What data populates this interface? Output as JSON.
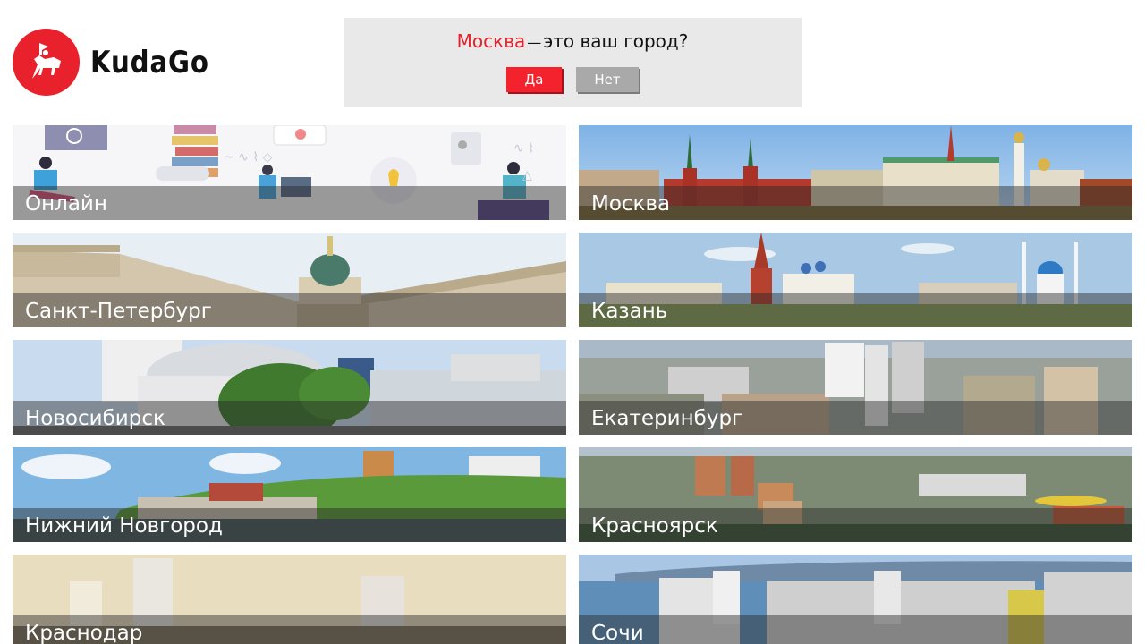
{
  "logo": {
    "text": "KudaGo"
  },
  "confirm": {
    "city": "Москва",
    "dash": "—",
    "question": "это ваш город?",
    "yes_label": "Да",
    "no_label": "Нет"
  },
  "cities": [
    {
      "label": "Онлайн"
    },
    {
      "label": "Москва"
    },
    {
      "label": "Санкт-Петербург"
    },
    {
      "label": "Казань"
    },
    {
      "label": "Новосибирск"
    },
    {
      "label": "Екатеринбург"
    },
    {
      "label": "Нижний Новгород"
    },
    {
      "label": "Красноярск"
    },
    {
      "label": "Краснодар"
    },
    {
      "label": "Сочи"
    }
  ],
  "colors": {
    "brand_red": "#e8212c",
    "popup_bg": "#e9e9e9",
    "no_button": "#a9a9a9"
  }
}
